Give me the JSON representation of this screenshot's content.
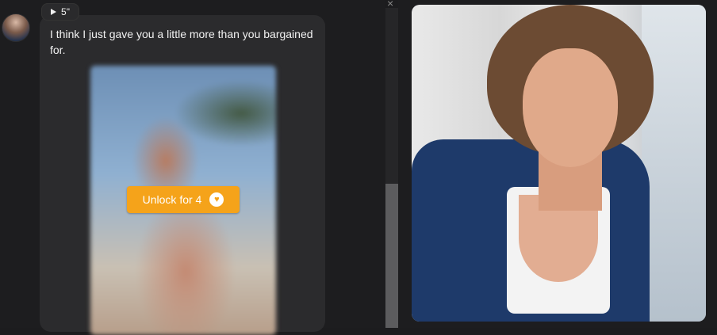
{
  "chat": {
    "audio_duration": "5\"",
    "message_text": "I think I just gave you a little more than you bargained for.",
    "unlock_label": "Unlock for 4"
  },
  "icons": {
    "play": "play-icon",
    "coin": "heart-coin-icon",
    "close": "close-icon"
  },
  "colors": {
    "unlock_button": "#f5a31a",
    "bubble_bg": "#2b2b2d"
  }
}
